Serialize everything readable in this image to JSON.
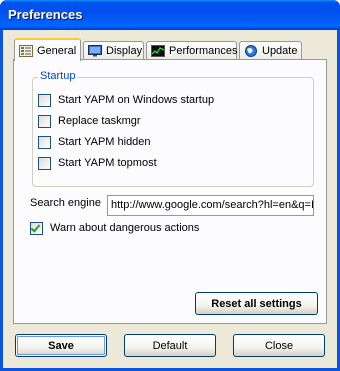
{
  "window": {
    "title": "Preferences"
  },
  "tabs": [
    {
      "label": "General",
      "icon": "general-settings-icon",
      "active": true
    },
    {
      "label": "Display",
      "icon": "monitor-icon",
      "active": false
    },
    {
      "label": "Performances",
      "icon": "performance-chart-icon",
      "active": false
    },
    {
      "label": "Update",
      "icon": "globe-icon",
      "active": false
    }
  ],
  "startup": {
    "group_label": "Startup",
    "options": [
      {
        "label": "Start YAPM on Windows startup",
        "checked": false
      },
      {
        "label": "Replace taskmgr",
        "checked": false
      },
      {
        "label": "Start YAPM hidden",
        "checked": false
      },
      {
        "label": "Start YAPM topmost",
        "checked": false
      }
    ]
  },
  "search_engine": {
    "label": "Search engine",
    "value": "http://www.google.com/search?hl=en&q=IT"
  },
  "warn_dangerous": {
    "label": "Warn about dangerous actions",
    "checked": true
  },
  "buttons": {
    "reset_all": "Reset all settings",
    "save": "Save",
    "default": "Default",
    "close": "Close"
  },
  "colors": {
    "titlebar": "#0054e3",
    "face": "#ece9d8",
    "group_label": "#0046d5",
    "check": "#21a121"
  }
}
